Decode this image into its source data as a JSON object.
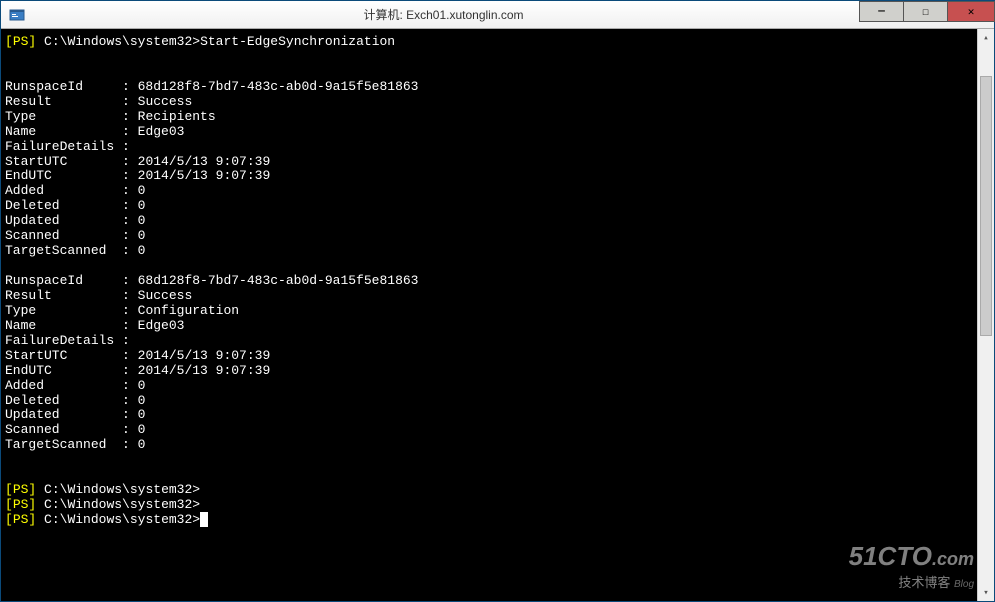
{
  "window": {
    "title": "计算机: Exch01.xutonglin.com"
  },
  "terminal": {
    "prompt_label": "PS",
    "prompt_path": "C:\\Windows\\system32>",
    "command": "Start-EdgeSynchronization",
    "block1": {
      "RunspaceId": "68d128f8-7bd7-483c-ab0d-9a15f5e81863",
      "Result": "Success",
      "Type": "Recipients",
      "Name": "Edge03",
      "FailureDetails": "",
      "StartUTC": "2014/5/13 9:07:39",
      "EndUTC": "2014/5/13 9:07:39",
      "Added": "0",
      "Deleted": "0",
      "Updated": "0",
      "Scanned": "0",
      "TargetScanned": "0"
    },
    "block2": {
      "RunspaceId": "68d128f8-7bd7-483c-ab0d-9a15f5e81863",
      "Result": "Success",
      "Type": "Configuration",
      "Name": "Edge03",
      "FailureDetails": "",
      "StartUTC": "2014/5/13 9:07:39",
      "EndUTC": "2014/5/13 9:07:39",
      "Added": "0",
      "Deleted": "0",
      "Updated": "0",
      "Scanned": "0",
      "TargetScanned": "0"
    },
    "labels": {
      "RunspaceId": "RunspaceId",
      "Result": "Result",
      "Type": "Type",
      "Name": "Name",
      "FailureDetails": "FailureDetails",
      "StartUTC": "StartUTC",
      "EndUTC": "EndUTC",
      "Added": "Added",
      "Deleted": "Deleted",
      "Updated": "Updated",
      "Scanned": "Scanned",
      "TargetScanned": "TargetScanned"
    }
  },
  "watermark": {
    "main": "51CTO",
    "suffix": ".com",
    "sub": "技术博客",
    "blog": "Blog"
  }
}
